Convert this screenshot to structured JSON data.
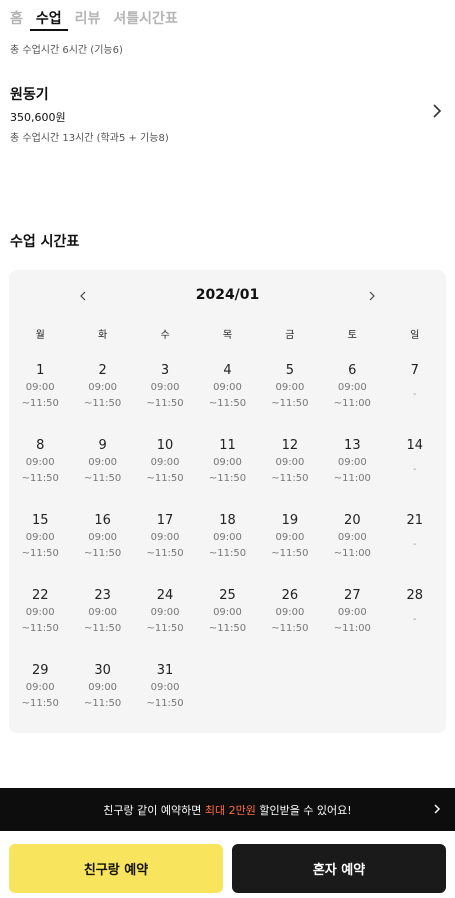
{
  "tabs": [
    {
      "label": "홈",
      "active": false
    },
    {
      "label": "수업",
      "active": true
    },
    {
      "label": "리뷰",
      "active": false
    },
    {
      "label": "셔틀시간표",
      "active": false
    }
  ],
  "total_hours": "총 수업시간 6시간 (기능6)",
  "course": {
    "name": "원동기",
    "price": "350,600원",
    "detail": "총 수업시간 13시간 (학과5 + 기능8)",
    "chevron_icon": "chevron-right-icon"
  },
  "schedule": {
    "title": "수업 시간표",
    "month": "2024/01",
    "prev_icon": "chevron-left-icon",
    "next_icon": "chevron-right-icon",
    "weekdays": [
      "월",
      "화",
      "수",
      "목",
      "금",
      "토",
      "일"
    ],
    "days": [
      {
        "num": "1",
        "start": "09:00",
        "end": "~11:50"
      },
      {
        "num": "2",
        "start": "09:00",
        "end": "~11:50"
      },
      {
        "num": "3",
        "start": "09:00",
        "end": "~11:50"
      },
      {
        "num": "4",
        "start": "09:00",
        "end": "~11:50"
      },
      {
        "num": "5",
        "start": "09:00",
        "end": "~11:50"
      },
      {
        "num": "6",
        "start": "09:00",
        "end": "~11:00"
      },
      {
        "num": "7",
        "empty": "-"
      },
      {
        "num": "8",
        "start": "09:00",
        "end": "~11:50"
      },
      {
        "num": "9",
        "start": "09:00",
        "end": "~11:50"
      },
      {
        "num": "10",
        "start": "09:00",
        "end": "~11:50"
      },
      {
        "num": "11",
        "start": "09:00",
        "end": "~11:50"
      },
      {
        "num": "12",
        "start": "09:00",
        "end": "~11:50"
      },
      {
        "num": "13",
        "start": "09:00",
        "end": "~11:00"
      },
      {
        "num": "14",
        "empty": "-"
      },
      {
        "num": "15",
        "start": "09:00",
        "end": "~11:50"
      },
      {
        "num": "16",
        "start": "09:00",
        "end": "~11:50"
      },
      {
        "num": "17",
        "start": "09:00",
        "end": "~11:50"
      },
      {
        "num": "18",
        "start": "09:00",
        "end": "~11:50"
      },
      {
        "num": "19",
        "start": "09:00",
        "end": "~11:50"
      },
      {
        "num": "20",
        "start": "09:00",
        "end": "~11:00"
      },
      {
        "num": "21",
        "empty": "-"
      },
      {
        "num": "22",
        "start": "09:00",
        "end": "~11:50"
      },
      {
        "num": "23",
        "start": "09:00",
        "end": "~11:50"
      },
      {
        "num": "24",
        "start": "09:00",
        "end": "~11:50"
      },
      {
        "num": "25",
        "start": "09:00",
        "end": "~11:50"
      },
      {
        "num": "26",
        "start": "09:00",
        "end": "~11:50"
      },
      {
        "num": "27",
        "start": "09:00",
        "end": "~11:00"
      },
      {
        "num": "28",
        "empty": "-"
      },
      {
        "num": "29",
        "start": "09:00",
        "end": "~11:50"
      },
      {
        "num": "30",
        "start": "09:00",
        "end": "~11:50"
      },
      {
        "num": "31",
        "start": "09:00",
        "end": "~11:50"
      }
    ]
  },
  "promo": {
    "text_before": "친구랑 같이 예약하면 ",
    "highlight": "최대 2만원",
    "text_after": " 할인받을 수 있어요!",
    "highlight_color": "#ff6a3d",
    "chevron_icon": "chevron-right-icon"
  },
  "buttons": {
    "friend": "친구랑 예약",
    "solo": "혼자 예약",
    "friend_color": "#f8e45d",
    "solo_color": "#1a1a1a"
  }
}
